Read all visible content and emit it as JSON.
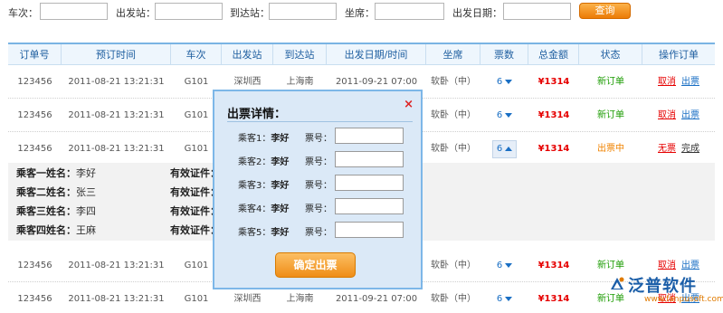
{
  "search": {
    "train_label": "车次：",
    "from_label": "出发站：",
    "to_label": "到达站：",
    "seat_label": "坐席：",
    "date_label": "出发日期：",
    "query_button": "查询"
  },
  "table": {
    "headers": [
      "订单号",
      "预订时间",
      "车次",
      "出发站",
      "到达站",
      "出发日期/时间",
      "坐席",
      "票数",
      "总金额",
      "状态",
      "操作订单"
    ],
    "rows": [
      {
        "order": "123456",
        "booked": "2011-08-21 13:21:31",
        "train": "G101",
        "from": "深圳西",
        "to": "上海南",
        "depart": "2011-09-21 07:00",
        "seat": "软卧（中）",
        "tickets": "6",
        "amount": "¥1314",
        "status": "新订单",
        "act1": "取消",
        "act2": "出票"
      },
      {
        "order": "123456",
        "booked": "2011-08-21 13:21:31",
        "train": "G101",
        "from": "",
        "to": "",
        "depart": "",
        "seat": "软卧（中）",
        "tickets": "6",
        "amount": "¥1314",
        "status": "新订单",
        "act1": "取消",
        "act2": "出票"
      },
      {
        "order": "123456",
        "booked": "2011-08-21 13:21:31",
        "train": "G101",
        "from": "",
        "to": "",
        "depart": "",
        "seat": "软卧（中）",
        "tickets": "6",
        "amount": "¥1314",
        "status": "出票中",
        "act1": "无票",
        "act2": "完成"
      },
      {
        "order": "123456",
        "booked": "2011-08-21 13:21:31",
        "train": "G101",
        "from": "",
        "to": "",
        "depart": "",
        "seat": "软卧（中）",
        "tickets": "6",
        "amount": "¥1314",
        "status": "新订单",
        "act1": "取消",
        "act2": "出票"
      },
      {
        "order": "123456",
        "booked": "2011-08-21 13:21:31",
        "train": "G101",
        "from": "深圳西",
        "to": "上海南",
        "depart": "2011-09-21 07:00",
        "seat": "软卧（中）",
        "tickets": "6",
        "amount": "¥1314",
        "status": "新订单",
        "act1": "取消",
        "act2": "出票"
      }
    ]
  },
  "passengers": [
    {
      "label": "乘客一姓名：",
      "name": "李好",
      "id_label": "有效证件："
    },
    {
      "label": "乘客二姓名：",
      "name": "张三",
      "id_label": "有效证件："
    },
    {
      "label": "乘客三姓名：",
      "name": "李四",
      "id_label": "有效证件："
    },
    {
      "label": "乘客四姓名：",
      "name": "王麻",
      "id_label": "有效证件："
    }
  ],
  "modal": {
    "title": "出票详情：",
    "close": "×",
    "rows": [
      {
        "passenger": "乘客1：",
        "name": "李好",
        "ticket_label": "票号："
      },
      {
        "passenger": "乘客2：",
        "name": "李好",
        "ticket_label": "票号："
      },
      {
        "passenger": "乘客3：",
        "name": "李好",
        "ticket_label": "票号："
      },
      {
        "passenger": "乘客4：",
        "name": "李好",
        "ticket_label": "票号："
      },
      {
        "passenger": "乘客5：",
        "name": "李好",
        "ticket_label": "票号："
      }
    ],
    "confirm_button": "确定出票"
  },
  "watermark": {
    "brand": "泛普软件",
    "url": "www.fanpusoft.com"
  },
  "colors": {
    "accent": "#1a6fc4",
    "amount": "#e60000",
    "new_status": "#1a9b00",
    "issuing_status": "#f08300",
    "button": "#ef8d17"
  }
}
